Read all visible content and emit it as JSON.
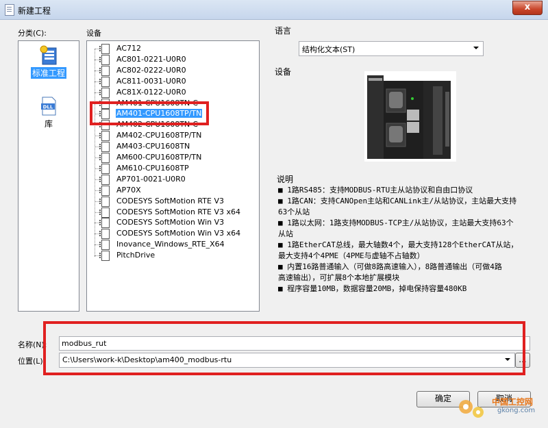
{
  "window": {
    "title": "新建工程",
    "close_glyph": "x"
  },
  "categories": {
    "label": "分类(C):",
    "items": [
      {
        "label": "标准工程",
        "icon": "project-icon",
        "selected": true
      },
      {
        "label": "库",
        "icon": "dll-library-icon",
        "icon_text": "DLL",
        "selected": false
      }
    ]
  },
  "devices": {
    "label": "设备",
    "items": [
      "AC712",
      "AC801-0221-U0R0",
      "AC802-0222-U0R0",
      "AC811-0031-U0R0",
      "AC81X-0122-U0R0",
      "AM401-CPU1608TN-C",
      "AM401-CPU1608TP/TN",
      "AM402-CPU1608TN-C",
      "AM402-CPU1608TP/TN",
      "AM403-CPU1608TN",
      "AM600-CPU1608TP/TN",
      "AM610-CPU1608TP",
      "AP701-0021-U0R0",
      "AP70X",
      "CODESYS SoftMotion RTE V3",
      "CODESYS SoftMotion RTE V3 x64",
      "CODESYS SoftMotion Win V3",
      "CODESYS SoftMotion Win V3 x64",
      "Inovance_Windows_RTE_X64",
      "PitchDrive"
    ],
    "selected": "AM401-CPU1608TP/TN"
  },
  "language": {
    "label": "语言",
    "value": "结构化文本(ST)"
  },
  "device_preview": {
    "label": "设备"
  },
  "description": {
    "label": "说明",
    "lines": [
      "■ 1路RS485：支持MODBUS-RTU主从站协议和自由口协议",
      "■ 1路CAN：支持CANOpen主站和CANLink主/从站协议，主站最大支持",
      "63个从站",
      "■ 1路以太网：1路支持MODBUS-TCP主/从站协议，主站最大支持63个",
      "从站",
      "■ 1路EtherCAT总线，最大轴数4个，最大支持128个EtherCAT从站，",
      "最大支持4个4PME（4PME与虚轴不占轴数）",
      "■ 内置16路普通输入（可做8路高速输入），8路普通输出（可做4路",
      "高速输出），可扩展8个本地扩展模块",
      "■ 程序容量10MB，数据容量20MB，掉电保持容量480KB"
    ]
  },
  "name_field": {
    "label": "名称(N):",
    "value": "modbus_rut"
  },
  "location_field": {
    "label": "位置(L):",
    "value": "C:\\Users\\work-k\\Desktop\\am400_modbus-rtu",
    "browse_label": "..."
  },
  "buttons": {
    "ok": "确定",
    "cancel": "取消"
  },
  "watermark": {
    "text": "中国工控网",
    "url": "gkong.com"
  },
  "colors": {
    "selection": "#3399ff",
    "highlight_box": "#e02020"
  }
}
